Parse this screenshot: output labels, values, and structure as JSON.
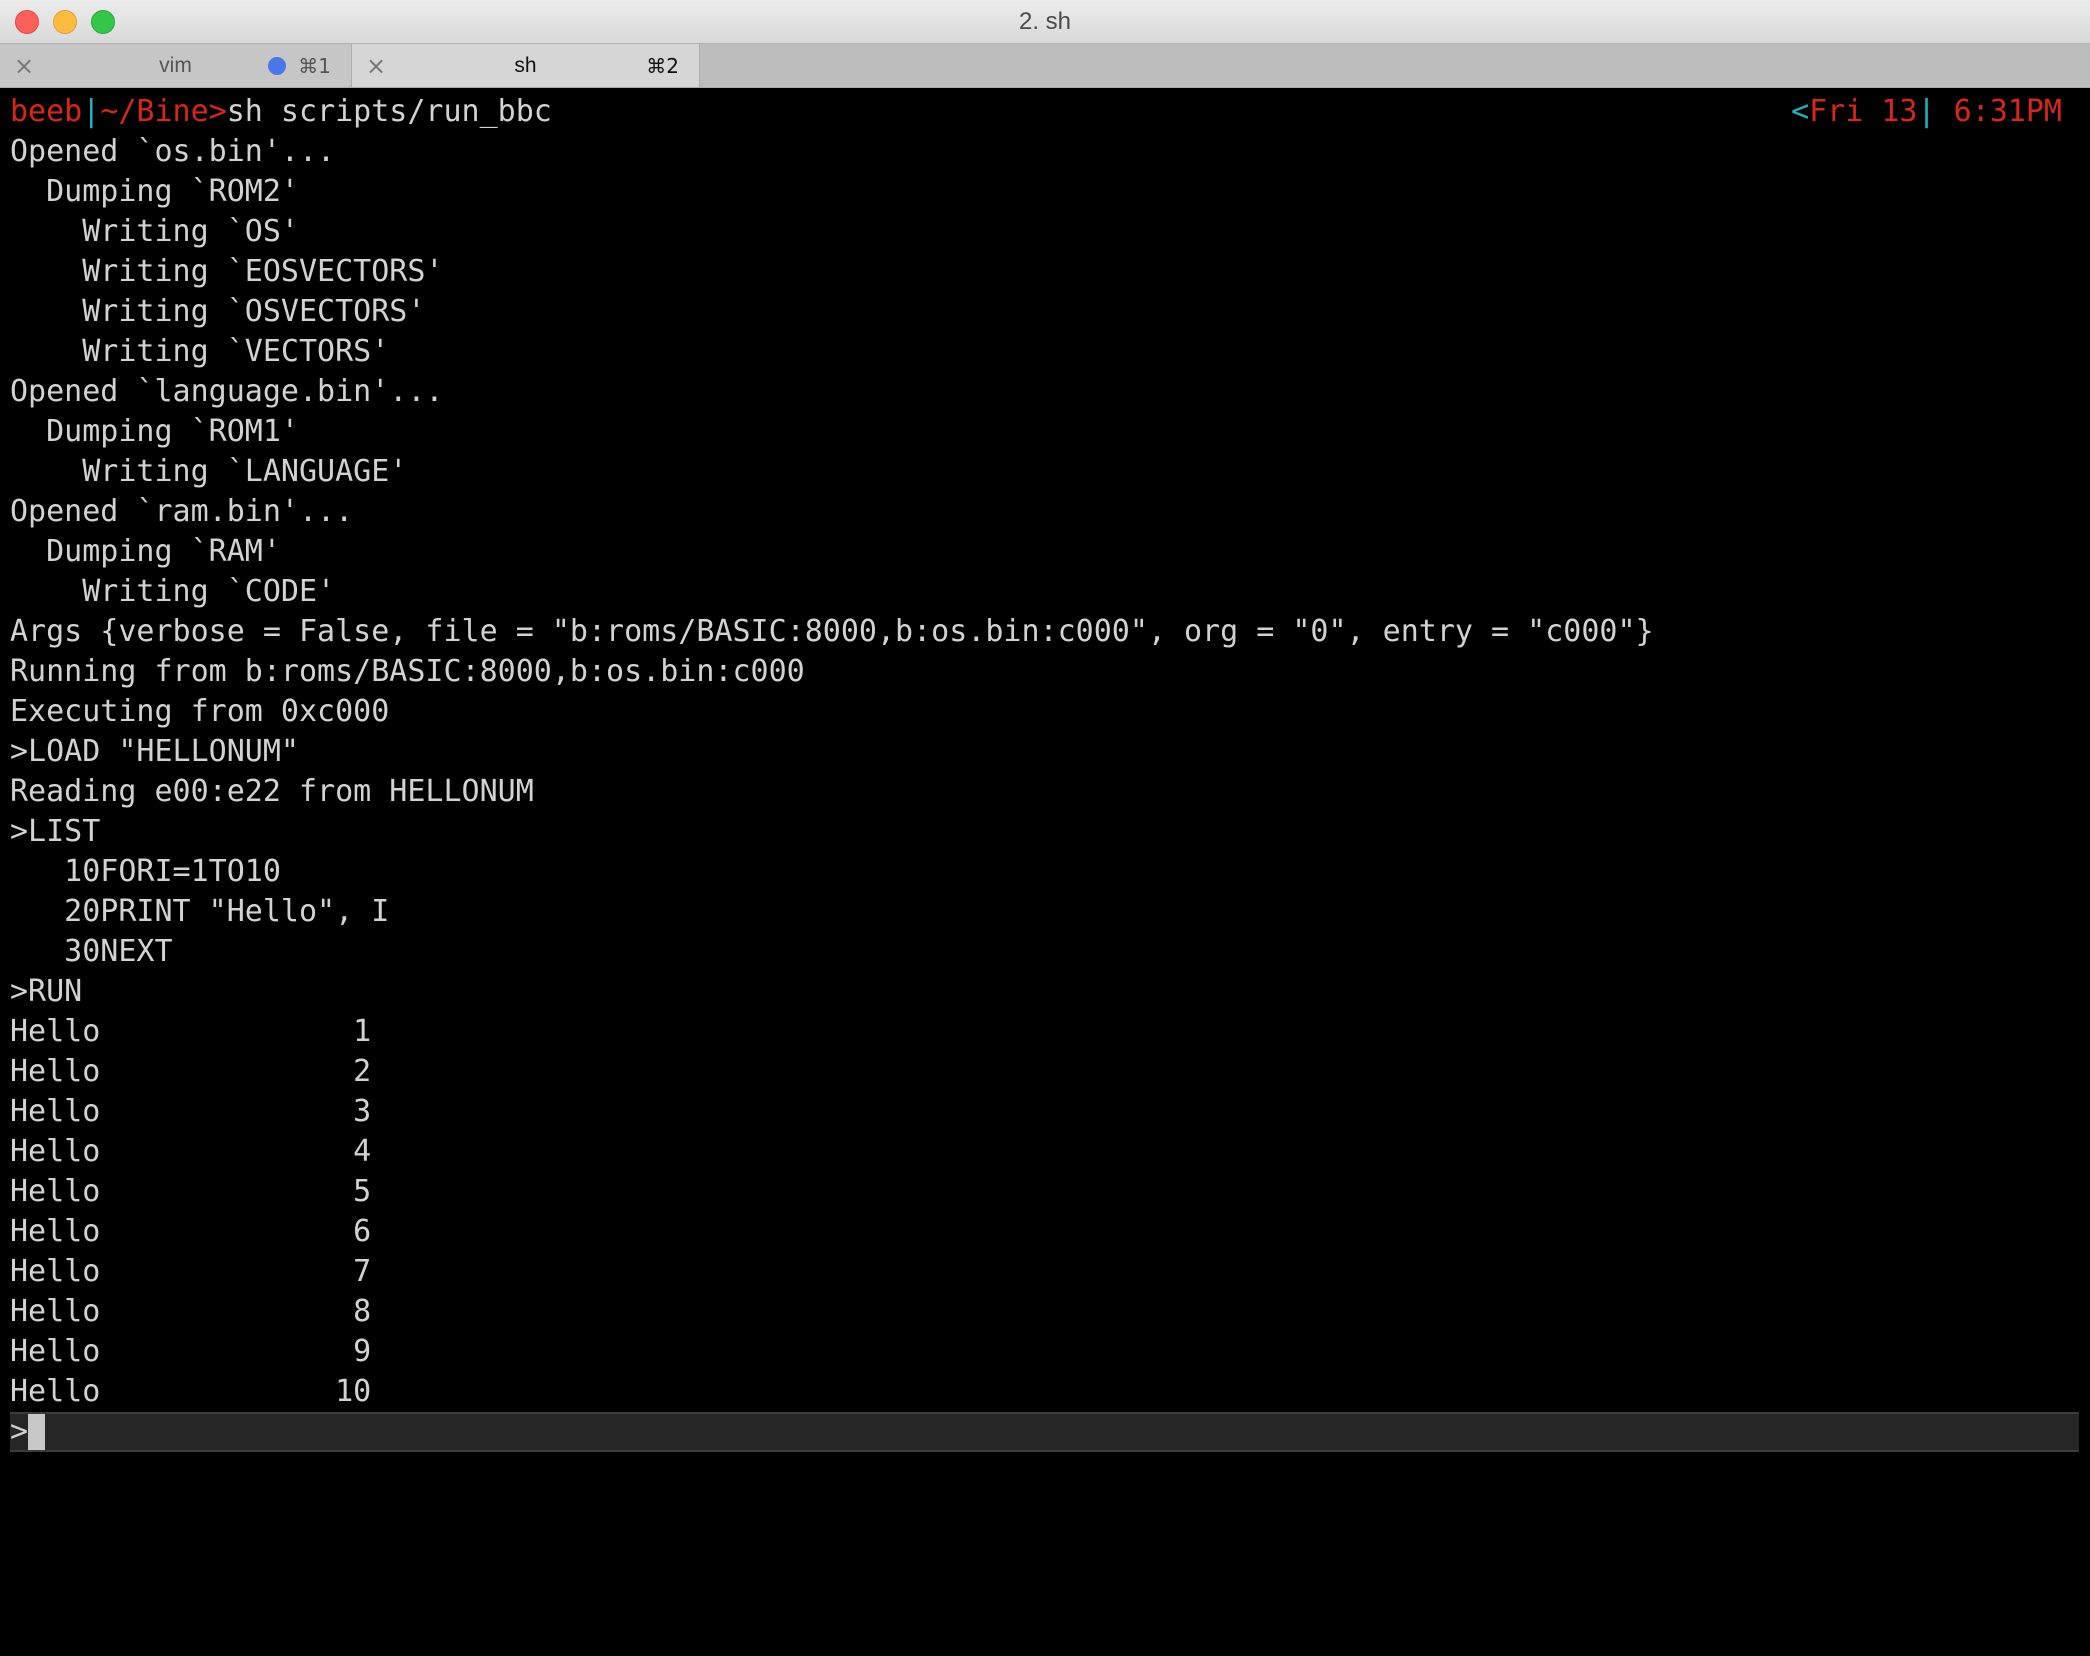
{
  "window": {
    "title": "2. sh",
    "traffic_lights": [
      "close",
      "minimize",
      "maximize"
    ]
  },
  "tabs": [
    {
      "label": "vim",
      "shortcut": "⌘1",
      "close_icon": "×",
      "active": false,
      "activity_dot": true
    },
    {
      "label": "sh",
      "shortcut": "⌘2",
      "close_icon": "×",
      "active": true,
      "activity_dot": false
    }
  ],
  "prompt": {
    "host": "beeb",
    "sep": "|",
    "path": "~/Bine",
    "gt": ">",
    "command": "sh scripts/run_bbc"
  },
  "right_prompt": {
    "lt": "<",
    "date": "Fri 13",
    "sep": "|",
    "time": " 6:31PM"
  },
  "output_lines": [
    "Opened `os.bin'...",
    "  Dumping `ROM2'",
    "    Writing `OS'",
    "    Writing `EOSVECTORS'",
    "    Writing `OSVECTORS'",
    "    Writing `VECTORS'",
    "Opened `language.bin'...",
    "  Dumping `ROM1'",
    "    Writing `LANGUAGE'",
    "Opened `ram.bin'...",
    "  Dumping `RAM'",
    "    Writing `CODE'",
    "Args {verbose = False, file = \"b:roms/BASIC:8000,b:os.bin:c000\", org = \"0\", entry = \"c000\"}",
    "Running from b:roms/BASIC:8000,b:os.bin:c000",
    "Executing from 0xc000",
    ">LOAD \"HELLONUM\"",
    "Reading e00:e22 from HELLONUM",
    ">LIST",
    "   10FORI=1TO10",
    "   20PRINT \"Hello\", I",
    "   30NEXT",
    ">RUN",
    "Hello              1",
    "Hello              2",
    "Hello              3",
    "Hello              4",
    "Hello              5",
    "Hello              6",
    "Hello              7",
    "Hello              8",
    "Hello              9",
    "Hello             10"
  ],
  "input": {
    "prompt": ">",
    "value": ""
  },
  "colors": {
    "prompt_red": "#d8261a",
    "prompt_cyan": "#1fb3c0",
    "text": "#d2d2d2",
    "background": "#000000",
    "activity_dot": "#4a78e8"
  }
}
